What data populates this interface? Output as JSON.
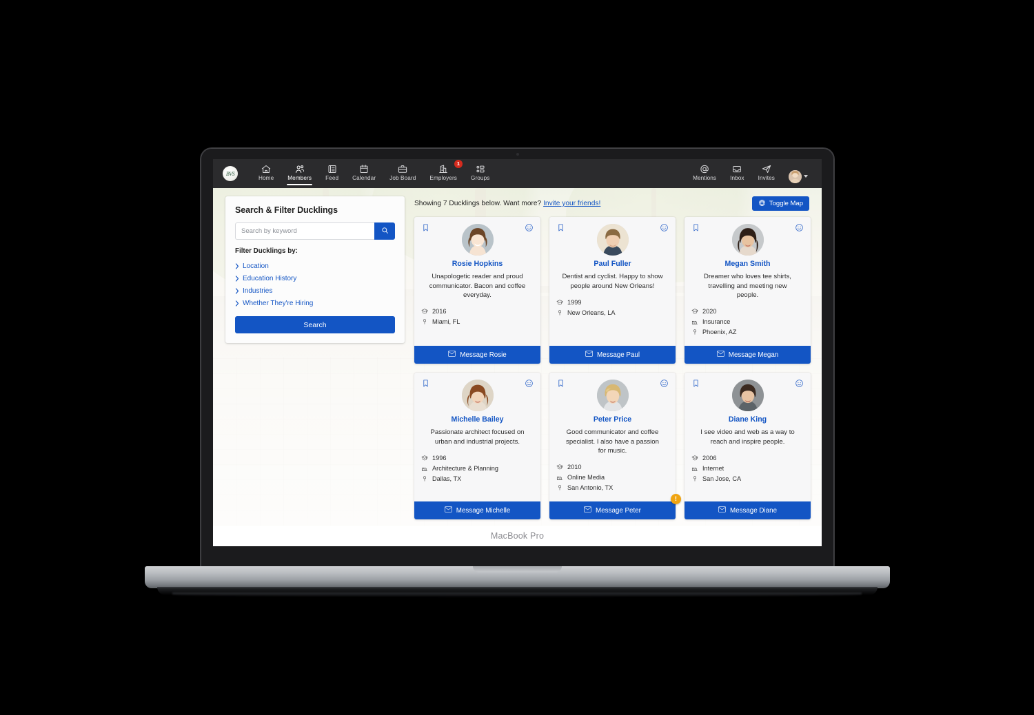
{
  "device": {
    "model_label": "MacBook Pro"
  },
  "navbar": {
    "brand": {
      "logo_text": "BVS",
      "name": "brand-logo"
    },
    "items": [
      {
        "label": "Home",
        "icon": "home-icon",
        "active": false,
        "badge": null
      },
      {
        "label": "Members",
        "icon": "members-icon",
        "active": true,
        "badge": null
      },
      {
        "label": "Feed",
        "icon": "feed-icon",
        "active": false,
        "badge": null
      },
      {
        "label": "Calendar",
        "icon": "calendar-icon",
        "active": false,
        "badge": null
      },
      {
        "label": "Job Board",
        "icon": "briefcase-icon",
        "active": false,
        "badge": null
      },
      {
        "label": "Employers",
        "icon": "building-icon",
        "active": false,
        "badge": "1"
      },
      {
        "label": "Groups",
        "icon": "groups-icon",
        "active": false,
        "badge": null
      }
    ],
    "right_items": [
      {
        "label": "Mentions",
        "icon": "at-icon"
      },
      {
        "label": "Inbox",
        "icon": "inbox-icon"
      },
      {
        "label": "Invites",
        "icon": "paper-plane-icon"
      }
    ],
    "account": {
      "avatar": "user-avatar",
      "caret": "chevron-down-icon"
    }
  },
  "filter_panel": {
    "title": "Search & Filter Ducklings",
    "search_placeholder": "Search by keyword",
    "search_value": "",
    "search_icon_button": "search-icon",
    "filters_heading": "Filter Ducklings by:",
    "filters": [
      {
        "label": "Location"
      },
      {
        "label": "Education History"
      },
      {
        "label": "Industries"
      },
      {
        "label": "Whether They're Hiring"
      }
    ],
    "submit_label": "Search"
  },
  "results": {
    "count_text": "Showing 7 Ducklings below. Want more?",
    "invite_link": "Invite your friends!",
    "toggle_map_label": "Toggle Map",
    "cards": [
      {
        "name": "Rosie Hopkins",
        "bio": "Unapologetic reader and proud communicator. Bacon and coffee everyday.",
        "meta": [
          {
            "icon": "graduation-cap-icon",
            "text": "2016"
          },
          {
            "icon": "location-pin-icon",
            "text": "Miami, FL"
          }
        ],
        "action_label": "Message Rosie",
        "alert": null
      },
      {
        "name": "Paul Fuller",
        "bio": "Dentist and cyclist. Happy to show people around New Orleans!",
        "meta": [
          {
            "icon": "graduation-cap-icon",
            "text": "1999"
          },
          {
            "icon": "location-pin-icon",
            "text": "New Orleans, LA"
          }
        ],
        "action_label": "Message Paul",
        "alert": null
      },
      {
        "name": "Megan Smith",
        "bio": "Dreamer who loves tee shirts, travelling and meeting new people.",
        "meta": [
          {
            "icon": "graduation-cap-icon",
            "text": "2020"
          },
          {
            "icon": "industry-icon",
            "text": "Insurance"
          },
          {
            "icon": "location-pin-icon",
            "text": "Phoenix, AZ"
          }
        ],
        "action_label": "Message Megan",
        "alert": null
      },
      {
        "name": "Michelle Bailey",
        "bio": "Passionate architect focused on urban and industrial projects.",
        "meta": [
          {
            "icon": "graduation-cap-icon",
            "text": "1996"
          },
          {
            "icon": "industry-icon",
            "text": "Architecture & Planning"
          },
          {
            "icon": "location-pin-icon",
            "text": "Dallas, TX"
          }
        ],
        "action_label": "Message Michelle",
        "alert": null
      },
      {
        "name": "Peter Price",
        "bio": "Good communicator and coffee specialist. I also have a passion for music.",
        "meta": [
          {
            "icon": "graduation-cap-icon",
            "text": "2010"
          },
          {
            "icon": "industry-icon",
            "text": "Online Media"
          },
          {
            "icon": "location-pin-icon",
            "text": "San Antonio, TX"
          }
        ],
        "action_label": "Message Peter",
        "alert": "!"
      },
      {
        "name": "Diane King",
        "bio": "I see video and web as a way to reach and inspire people.",
        "meta": [
          {
            "icon": "graduation-cap-icon",
            "text": "2006"
          },
          {
            "icon": "industry-icon",
            "text": "Internet"
          },
          {
            "icon": "location-pin-icon",
            "text": "San Jose, CA"
          }
        ],
        "action_label": "Message Diane",
        "alert": null
      }
    ]
  },
  "colors": {
    "accent_blue": "#1355c4",
    "nav_dark": "#2b2b2d",
    "badge_red": "#d52b1e",
    "alert_orange": "#f0a411",
    "card_bg": "#f7f7f8"
  }
}
